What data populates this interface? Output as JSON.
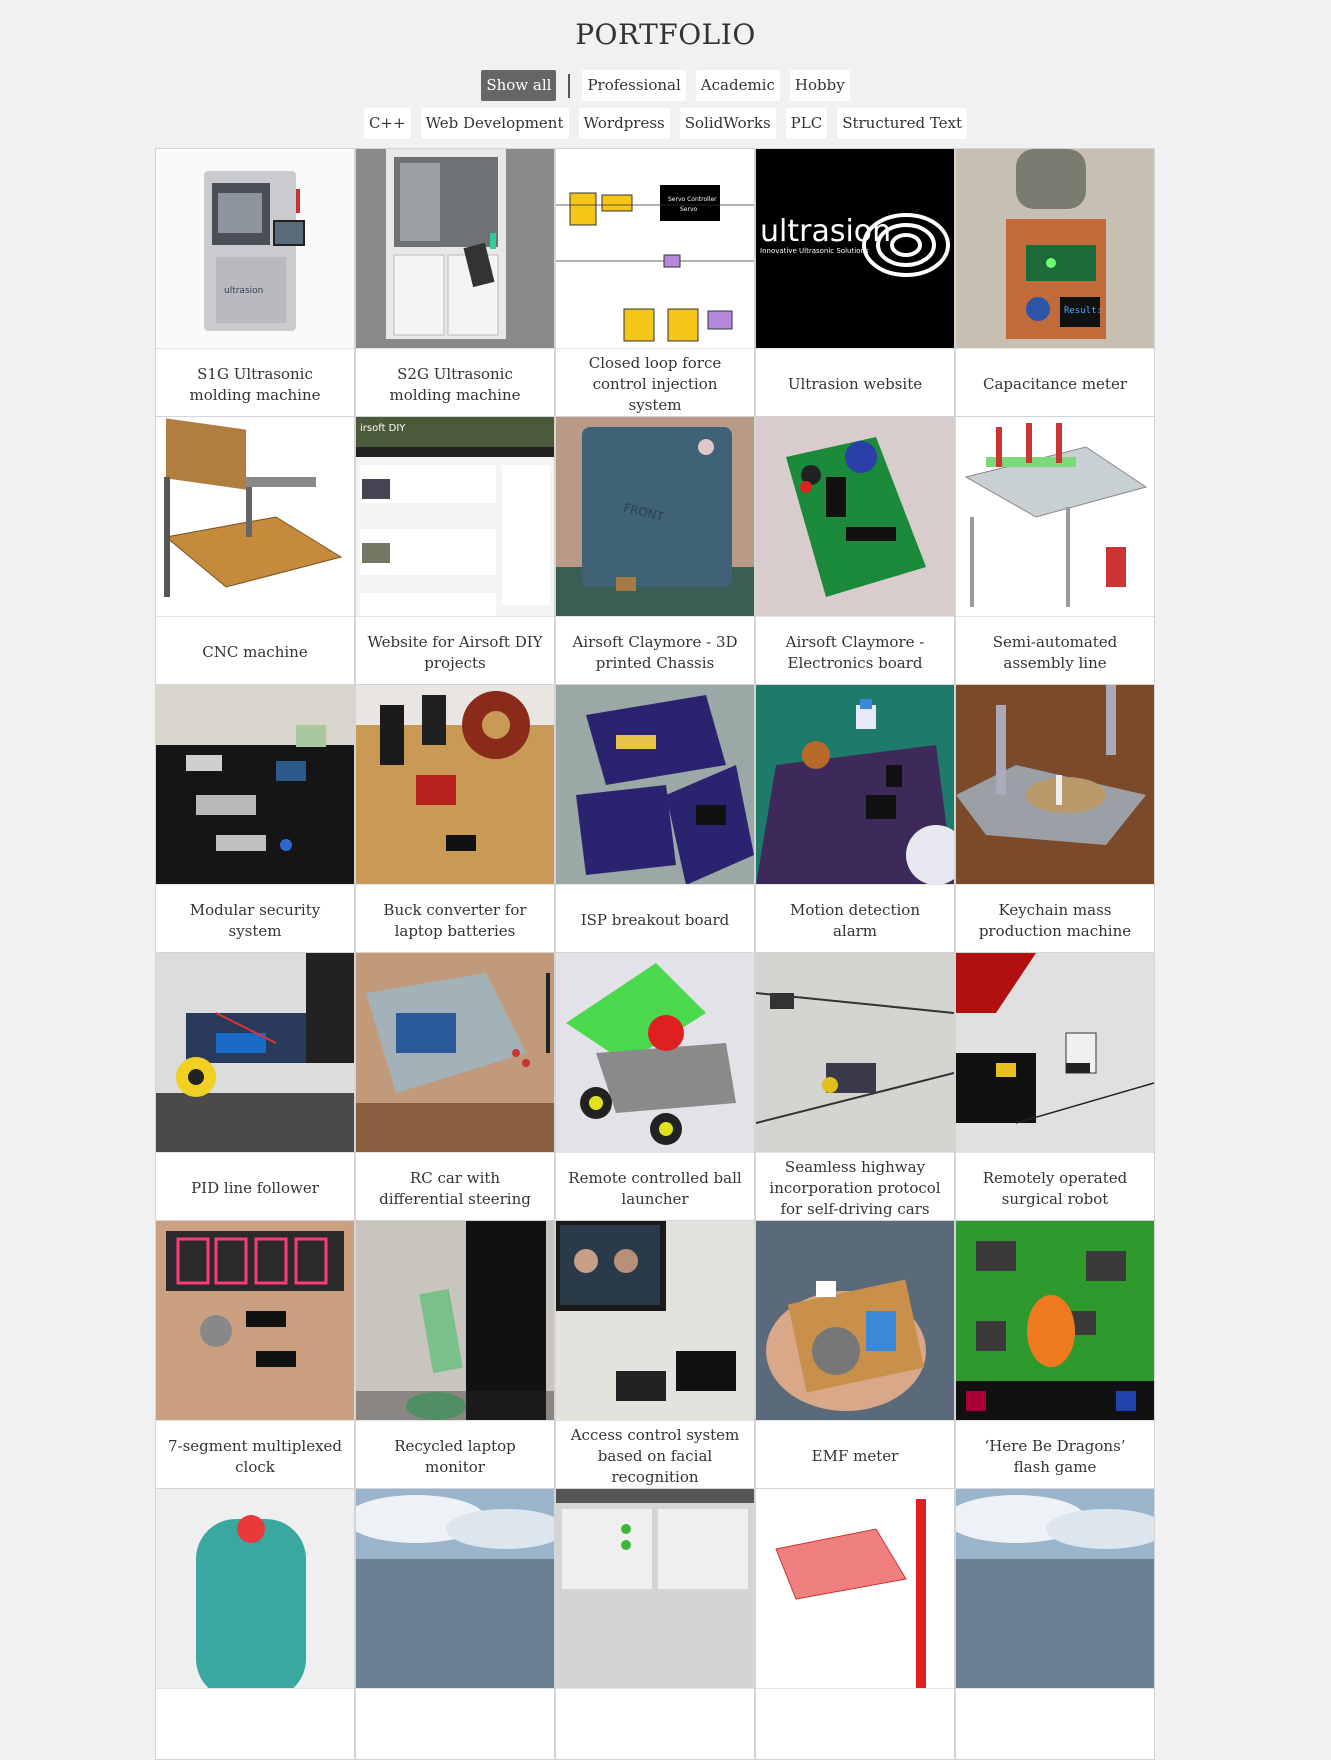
{
  "page_title": "PORTFOLIO",
  "filters_primary": [
    {
      "label": "Show all",
      "active": true
    },
    {
      "label": "Professional",
      "active": false
    },
    {
      "label": "Academic",
      "active": false
    },
    {
      "label": "Hobby",
      "active": false
    }
  ],
  "filters_secondary": [
    {
      "label": "C++"
    },
    {
      "label": "Web Development"
    },
    {
      "label": "Wordpress"
    },
    {
      "label": "SolidWorks"
    },
    {
      "label": "PLC"
    },
    {
      "label": "Structured Text"
    }
  ],
  "projects": [
    {
      "title": "S1G Ultrasonic molding machine",
      "thumb": "machine-steel"
    },
    {
      "title": "S2G Ultrasonic molding machine",
      "thumb": "machine-cabinet"
    },
    {
      "title": "Closed loop force control injection system",
      "thumb": "block-diagram"
    },
    {
      "title": "Ultrasion website",
      "thumb": "logo-dark"
    },
    {
      "title": "Capacitance meter",
      "thumb": "pcb-orange"
    },
    {
      "title": "CNC machine",
      "thumb": "cnc-cad"
    },
    {
      "title": "Website for Airsoft DIY projects",
      "thumb": "website"
    },
    {
      "title": "Airsoft Claymore - 3D printed Chassis",
      "thumb": "blue-box"
    },
    {
      "title": "Airsoft Claymore - Electronics board",
      "thumb": "pcb-green"
    },
    {
      "title": "Semi-automated assembly line",
      "thumb": "assembly-cad"
    },
    {
      "title": "Modular security system",
      "thumb": "dark-table"
    },
    {
      "title": "Buck converter for laptop batteries",
      "thumb": "perfboard"
    },
    {
      "title": "ISP breakout board",
      "thumb": "purple-pcb"
    },
    {
      "title": "Motion detection alarm",
      "thumb": "purple-board"
    },
    {
      "title": "Keychain mass production machine",
      "thumb": "metal-plate"
    },
    {
      "title": "PID line follower",
      "thumb": "robot-car"
    },
    {
      "title": "RC car with differential steering",
      "thumb": "rc-car"
    },
    {
      "title": "Remote controlled ball launcher",
      "thumb": "ball-launcher"
    },
    {
      "title": "Seamless highway incorporation protocol for self-driving cars",
      "thumb": "floor-cars"
    },
    {
      "title": "Remotely operated surgical robot",
      "thumb": "laptop-desk"
    },
    {
      "title": "7-segment multiplexed clock",
      "thumb": "seven-seg"
    },
    {
      "title": "Recycled laptop monitor",
      "thumb": "monitor"
    },
    {
      "title": "Access control system based on facial recognition",
      "thumb": "face-screen"
    },
    {
      "title": "EMF meter",
      "thumb": "hand-pcb"
    },
    {
      "title": "‘Here Be Dragons’ flash game",
      "thumb": "game"
    },
    {
      "title": "",
      "thumb": "teal-device"
    },
    {
      "title": "",
      "thumb": "sky"
    },
    {
      "title": "",
      "thumb": "gui-panel"
    },
    {
      "title": "",
      "thumb": "plot-3d"
    },
    {
      "title": "",
      "thumb": "sky"
    }
  ]
}
